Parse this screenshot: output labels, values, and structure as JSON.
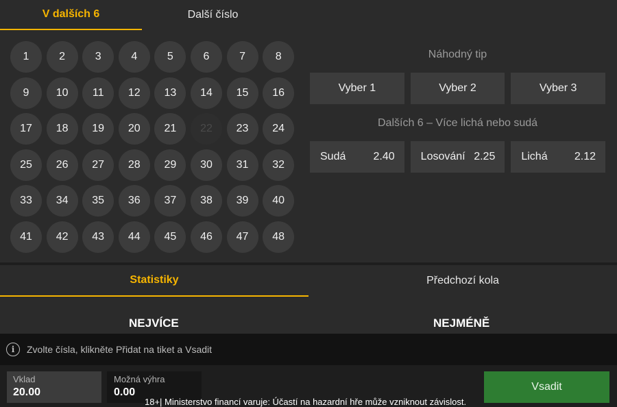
{
  "tabs": [
    {
      "label": "V dalších 6",
      "active": true
    },
    {
      "label": "Další číslo",
      "active": false
    }
  ],
  "numbers": [
    1,
    2,
    3,
    4,
    5,
    6,
    7,
    8,
    9,
    10,
    11,
    12,
    13,
    14,
    15,
    16,
    17,
    18,
    19,
    20,
    21,
    22,
    23,
    24,
    25,
    26,
    27,
    28,
    29,
    30,
    31,
    32,
    33,
    34,
    35,
    36,
    37,
    38,
    39,
    40,
    41,
    42,
    43,
    44,
    45,
    46,
    47,
    48
  ],
  "disabled_numbers": [
    22
  ],
  "random_tip": {
    "heading": "Náhodný tip",
    "buttons": [
      "Vyber 1",
      "Vyber 2",
      "Vyber 3"
    ]
  },
  "odd_even": {
    "heading": "Dalších 6 – Více lichá nebo sudá",
    "options": [
      {
        "label": "Sudá",
        "odds": "2.40"
      },
      {
        "label": "Losování",
        "odds": "2.25"
      },
      {
        "label": "Lichá",
        "odds": "2.12"
      }
    ]
  },
  "stats_tabs": [
    {
      "label": "Statistiky",
      "active": true
    },
    {
      "label": "Předchozí kola",
      "active": false
    }
  ],
  "stats": {
    "most_title": "NEJVÍCE",
    "least_title": "NEJMÉNĚ"
  },
  "info": {
    "icon": "info-circle-icon",
    "text": "Zvolte čísla, klikněte Přidat na tiket a Vsadit"
  },
  "bet_slip": {
    "stake_label": "Vklad",
    "stake_value": "20.00",
    "win_label": "Možná výhra",
    "win_value": "0.00",
    "bet_button": "Vsadit"
  },
  "warning": "18+| Ministerstvo financí varuje: Účastí na hazardní hře může vzniknout závislost.",
  "colors": {
    "accent": "#f7b500",
    "panel": "#2b2b2b",
    "ball": "#3c3c3c",
    "bet_button": "#2e7d32"
  }
}
